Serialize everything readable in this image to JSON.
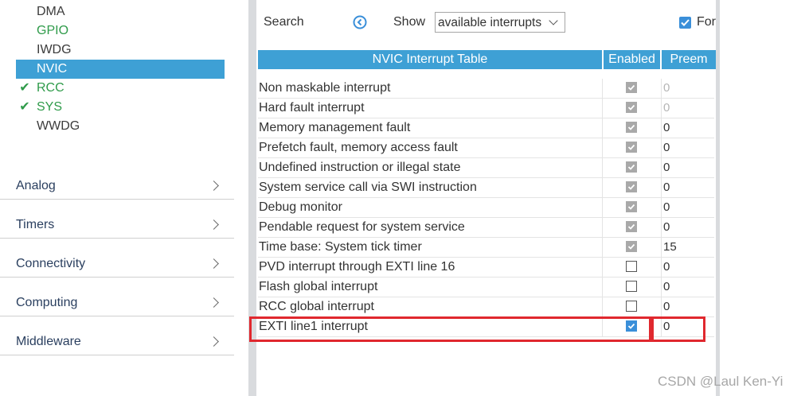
{
  "sidebar": {
    "system_items": [
      {
        "label": "DMA",
        "status": "none"
      },
      {
        "label": "GPIO",
        "status": "green"
      },
      {
        "label": "IWDG",
        "status": "none"
      },
      {
        "label": "NVIC",
        "status": "selected"
      },
      {
        "label": "RCC",
        "status": "checked"
      },
      {
        "label": "SYS",
        "status": "checked"
      },
      {
        "label": "WWDG",
        "status": "none"
      }
    ],
    "check_glyph": "✔",
    "categories": [
      {
        "label": "Analog"
      },
      {
        "label": "Timers"
      },
      {
        "label": "Connectivity"
      },
      {
        "label": "Computing"
      },
      {
        "label": "Middleware"
      }
    ]
  },
  "toolbar": {
    "search_label": "Search",
    "show_label": "Show",
    "show_value": "available interrupts",
    "force_label": "For"
  },
  "table": {
    "headers": {
      "name": "NVIC Interrupt Table",
      "enabled": "Enabled",
      "preemption": "Preem"
    },
    "rows": [
      {
        "name": "Non maskable interrupt",
        "enabled": "checked-disabled",
        "priority": "0",
        "priority_disabled": true
      },
      {
        "name": "Hard fault interrupt",
        "enabled": "checked-disabled",
        "priority": "0",
        "priority_disabled": true
      },
      {
        "name": "Memory management fault",
        "enabled": "checked-disabled",
        "priority": "0",
        "priority_disabled": false
      },
      {
        "name": "Prefetch fault, memory access fault",
        "enabled": "checked-disabled",
        "priority": "0",
        "priority_disabled": false
      },
      {
        "name": "Undefined instruction or illegal state",
        "enabled": "checked-disabled",
        "priority": "0",
        "priority_disabled": false
      },
      {
        "name": "System service call via SWI instruction",
        "enabled": "checked-disabled",
        "priority": "0",
        "priority_disabled": false
      },
      {
        "name": "Debug monitor",
        "enabled": "checked-disabled",
        "priority": "0",
        "priority_disabled": false
      },
      {
        "name": "Pendable request for system service",
        "enabled": "checked-disabled",
        "priority": "0",
        "priority_disabled": false
      },
      {
        "name": "Time base: System tick timer",
        "enabled": "checked-disabled",
        "priority": "15",
        "priority_disabled": false
      },
      {
        "name": "PVD interrupt through EXTI line 16",
        "enabled": "unchecked",
        "priority": "0",
        "priority_disabled": false
      },
      {
        "name": "Flash global interrupt",
        "enabled": "unchecked",
        "priority": "0",
        "priority_disabled": false
      },
      {
        "name": "RCC global interrupt",
        "enabled": "unchecked",
        "priority": "0",
        "priority_disabled": false
      },
      {
        "name": "EXTI line1 interrupt",
        "enabled": "checked-active",
        "priority": "0",
        "priority_disabled": false
      }
    ]
  },
  "watermark": "CSDN @Laul Ken-Yi",
  "colors": {
    "accent": "#3ea0d5",
    "green": "#2f9b4a",
    "highlight": "#e0282e"
  }
}
